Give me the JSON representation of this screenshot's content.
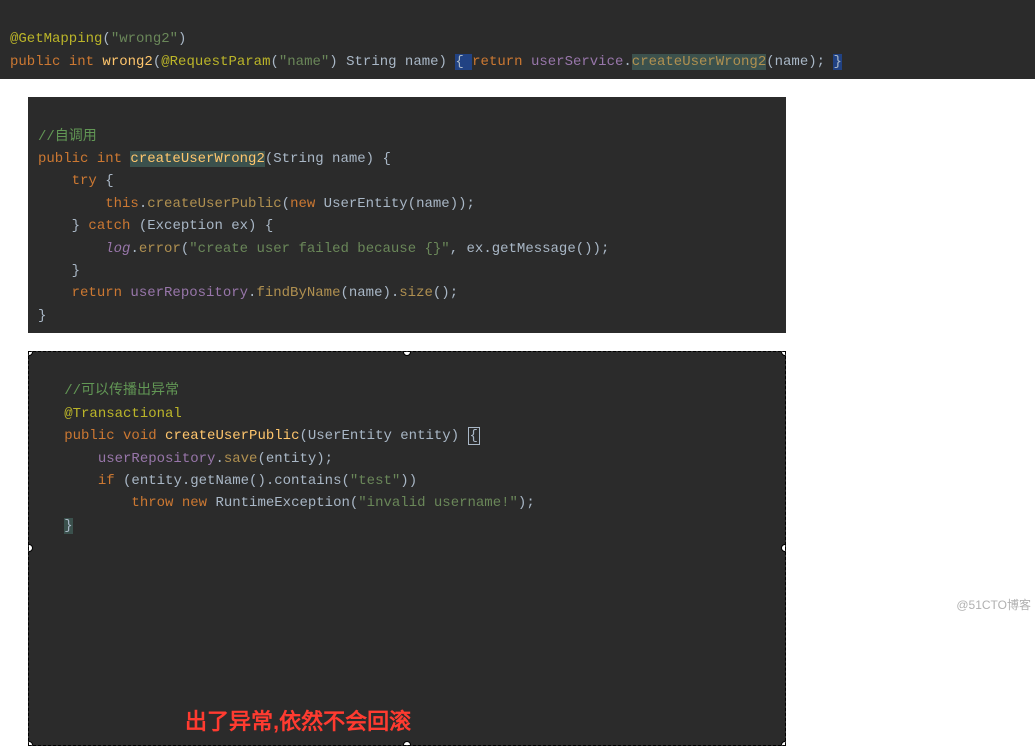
{
  "block1": {
    "l1": {
      "ann": "@GetMapping",
      "p1": "(",
      "str": "\"wrong2\"",
      "p2": ")"
    },
    "l2": {
      "kw1": "public ",
      "kw2": "int ",
      "method": "wrong2",
      "p1": "(",
      "ann": "@RequestParam",
      "p2": "(",
      "str": "\"name\"",
      "p3": ") ",
      "type": "String ",
      "param": "name",
      "p4": ") ",
      "brace1": "{ ",
      "kw3": "return ",
      "field": "userService",
      "dot": ".",
      "call": "createUserWrong2",
      "p5": "(",
      "arg": "name",
      "p6": "); ",
      "brace2": "}"
    }
  },
  "block2": {
    "c1": "//自调用",
    "l2": {
      "kw1": "public ",
      "kw2": "int ",
      "method": "createUserWrong2",
      "sig": "(String name) {"
    },
    "l3": {
      "kw": "try",
      "rest": " {"
    },
    "l4": {
      "kw": "this",
      "dot": ".",
      "call": "createUserPublic",
      "p1": "(",
      "kw2": "new ",
      "type": "UserEntity",
      "p2": "(name));"
    },
    "l5": {
      "p1": "} ",
      "kw": "catch",
      "rest": " (Exception ex) {"
    },
    "l6": {
      "log": "log",
      "dot": ".",
      "call": "error",
      "p1": "(",
      "str": "\"create user failed because {}\"",
      "p2": ", ex.getMessage());"
    },
    "l7": "}",
    "l8": {
      "kw": "return ",
      "field": "userRepository",
      "dot": ".",
      "call1": "findByName",
      "p1": "(name).",
      "call2": "size",
      "p2": "();"
    },
    "l9": "}"
  },
  "block3": {
    "c1": "//可以传播出异常",
    "l2": "@Transactional",
    "l3": {
      "kw1": "public ",
      "kw2": "void ",
      "method": "createUserPublic",
      "sig": "(UserEntity entity) ",
      "brace": "{"
    },
    "l4": {
      "field": "userRepository",
      "dot": ".",
      "call": "save",
      "rest": "(entity);"
    },
    "l5": {
      "kw": "if ",
      "rest1": "(entity.getName().contains(",
      "str": "\"test\"",
      "rest2": "))"
    },
    "l6": {
      "kw1": "throw ",
      "kw2": "new ",
      "type": "RuntimeException",
      "p1": "(",
      "str": "\"invalid username!\"",
      "p2": ");"
    },
    "l7": "}"
  },
  "red_text": "出了异常,依然不会回滚",
  "watermark": "@51CTO博客"
}
